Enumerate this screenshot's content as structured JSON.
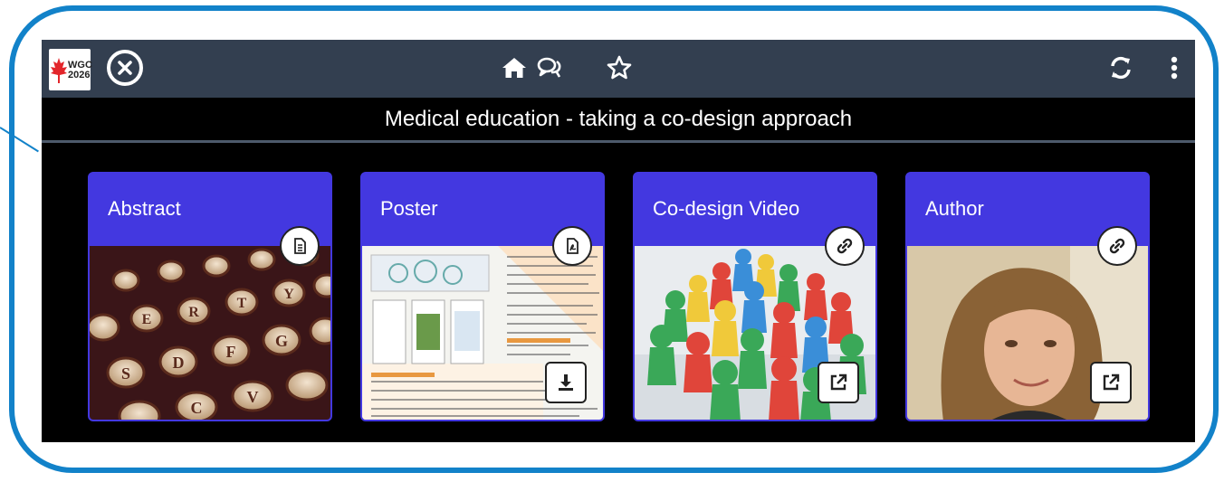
{
  "topbar": {
    "logo": {
      "line1": "WGC",
      "line2": "2026"
    },
    "icons": [
      "close-circle-icon",
      "home-icon",
      "chat-icon",
      "star-icon",
      "refresh-icon",
      "more-vertical-icon"
    ]
  },
  "page_title": "Medical education - taking a co-design approach",
  "cards": [
    {
      "label": "Abstract",
      "badge_icon": "document-icon",
      "image": "typewriter-keys"
    },
    {
      "label": "Poster",
      "badge_icon": "pdf-icon",
      "action_icon": "download-icon",
      "image": "poster-thumbnail"
    },
    {
      "label": "Co-design Video",
      "badge_icon": "link-icon",
      "action_icon": "external-link-icon",
      "image": "game-pawns"
    },
    {
      "label": "Author",
      "badge_icon": "link-icon",
      "action_icon": "external-link-icon",
      "image": "author-portrait"
    }
  ],
  "colors": {
    "frame": "#1282c9",
    "topbar": "#333f50",
    "card": "#4338e0"
  }
}
